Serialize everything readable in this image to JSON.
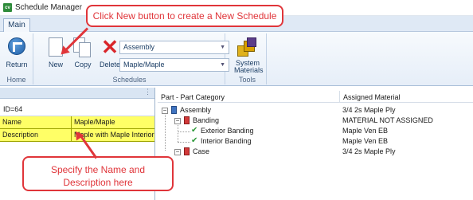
{
  "window": {
    "title": "Schedule Manager",
    "logo_text": "cv"
  },
  "tabs": [
    {
      "label": "Main"
    }
  ],
  "ribbon": {
    "home": {
      "group_label": "Home",
      "return_label": "Return"
    },
    "schedules": {
      "group_label": "Schedules",
      "new_label": "New",
      "copy_label": "Copy",
      "delete_label": "Delete",
      "combo1_value": "Assembly",
      "combo2_value": "Maple/Maple"
    },
    "tools": {
      "group_label": "Tools",
      "system_materials_label_1": "System",
      "system_materials_label_2": "Materials"
    }
  },
  "left_panel": {
    "id_text": "ID=64",
    "properties": [
      {
        "key": "Name",
        "value": "Maple/Maple"
      },
      {
        "key": "Description",
        "value": "Maple with Maple Interior"
      }
    ]
  },
  "tree": {
    "columns": [
      "Part - Part Category",
      "Assigned Material"
    ],
    "rows": [
      {
        "label": "Assembly",
        "material": "3/4 2s Maple Ply"
      },
      {
        "label": "Banding",
        "material": "MATERIAL NOT ASSIGNED"
      },
      {
        "label": "Exterior Banding",
        "material": "Maple Ven EB"
      },
      {
        "label": "Interior Banding",
        "material": "Maple Ven EB"
      },
      {
        "label": "Case",
        "material": "3/4 2s Maple Ply"
      }
    ]
  },
  "callouts": {
    "top": "Click New button to create a New Schedule",
    "bottom_line1": "Specify the Name and",
    "bottom_line2": "Description here"
  },
  "colors": {
    "accent": "#e0353a",
    "highlight": "#ffff66",
    "ribbon": "#e6eef8"
  },
  "icons": [
    "return-icon",
    "new-document-icon",
    "copy-icon",
    "delete-icon",
    "system-materials-icon",
    "dropdown-arrow-icon",
    "expander-icon",
    "node-icon",
    "checkmark-icon"
  ]
}
